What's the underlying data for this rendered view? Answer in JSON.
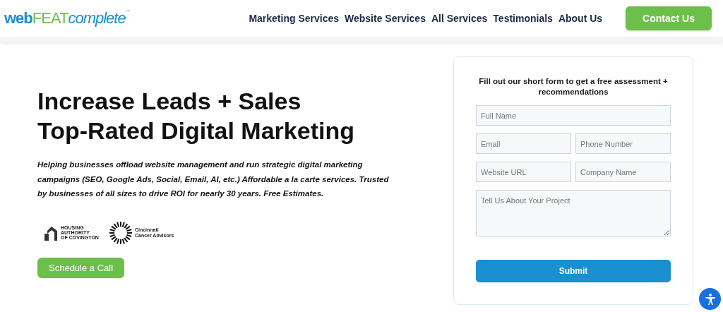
{
  "logo": {
    "part_1": "web",
    "part_2": "FEAT",
    "part_3": "complete",
    "mark": "™"
  },
  "nav": [
    "Marketing Services",
    "Website Services",
    "All Services",
    "Testimonials",
    "About Us"
  ],
  "contact_button": "Contact Us",
  "hero": {
    "headline_1": "Increase Leads + Sales",
    "headline_2": "Top-Rated Digital Marketing",
    "description": "Helping businesses offload website management and run strategic digital marketing campaigns (SEO, Google Ads, Social, Email, AI, etc.) Affordable a la carte services. Trusted by businesses of all sizes to drive ROI for nearly 30 years. Free Estimates.",
    "client_logos": [
      {
        "kind": "housing",
        "lines": [
          "HOUSING",
          "AUTHORITY",
          "OF COVINGTON"
        ]
      },
      {
        "kind": "sun",
        "lines": [
          "Cincinnati",
          "Cancer Advisors"
        ]
      }
    ],
    "cta": "Schedule a Call"
  },
  "form": {
    "title": "Fill out our short form to get a free assessment + recommendations",
    "rows": [
      [
        {
          "placeholder": "Full Name"
        }
      ],
      [
        {
          "placeholder": "Email"
        },
        {
          "placeholder": "Phone Number"
        }
      ],
      [
        {
          "placeholder": "Website URL"
        },
        {
          "placeholder": "Company Name"
        }
      ]
    ],
    "message": {
      "placeholder": "Tell Us About Your Project"
    },
    "submit": "Submit"
  }
}
